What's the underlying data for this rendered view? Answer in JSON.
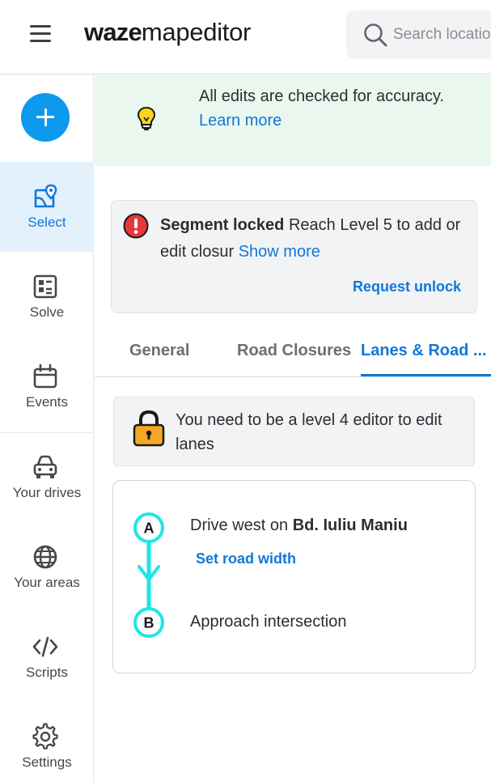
{
  "header": {
    "logo_bold": "waze",
    "logo_rest": "mapeditor",
    "search_placeholder": "Search location"
  },
  "sidebar": {
    "items": [
      {
        "label": "Select",
        "icon": "select-icon",
        "active": true
      },
      {
        "label": "Solve",
        "icon": "solve-icon"
      },
      {
        "label": "Events",
        "icon": "calendar-icon"
      },
      {
        "label": "Your drives",
        "icon": "car-icon"
      },
      {
        "label": "Your areas",
        "icon": "globe-icon"
      },
      {
        "label": "Scripts",
        "icon": "code-icon"
      },
      {
        "label": "Settings",
        "icon": "gear-icon"
      }
    ]
  },
  "banner": {
    "text": "All edits are checked for accuracy.",
    "link": "Learn more"
  },
  "lock_card": {
    "title": "Segment locked",
    "message": "Reach Level 5 to add or edit closur",
    "show_more": "Show more",
    "request": "Request unlock"
  },
  "tabs": [
    {
      "label": "General"
    },
    {
      "label": "Road Closures"
    },
    {
      "label": "Lanes & Road ...",
      "active": true
    }
  ],
  "lanes": {
    "note": "You need to be a level 4 editor to edit lanes",
    "route": {
      "point_a": "A",
      "point_b": "B",
      "step_a_prefix": "Drive west on",
      "step_a_road": "Bd. Iuliu Maniu",
      "road_width_link": "Set road width",
      "step_b": "Approach intersection"
    }
  },
  "colors": {
    "accent": "#1177d8",
    "add_button": "#0c99ee",
    "banner_bg": "#eaf7ef",
    "route_line": "#1ee6e6",
    "error": "#e8363d",
    "lock": "#f5a623"
  }
}
